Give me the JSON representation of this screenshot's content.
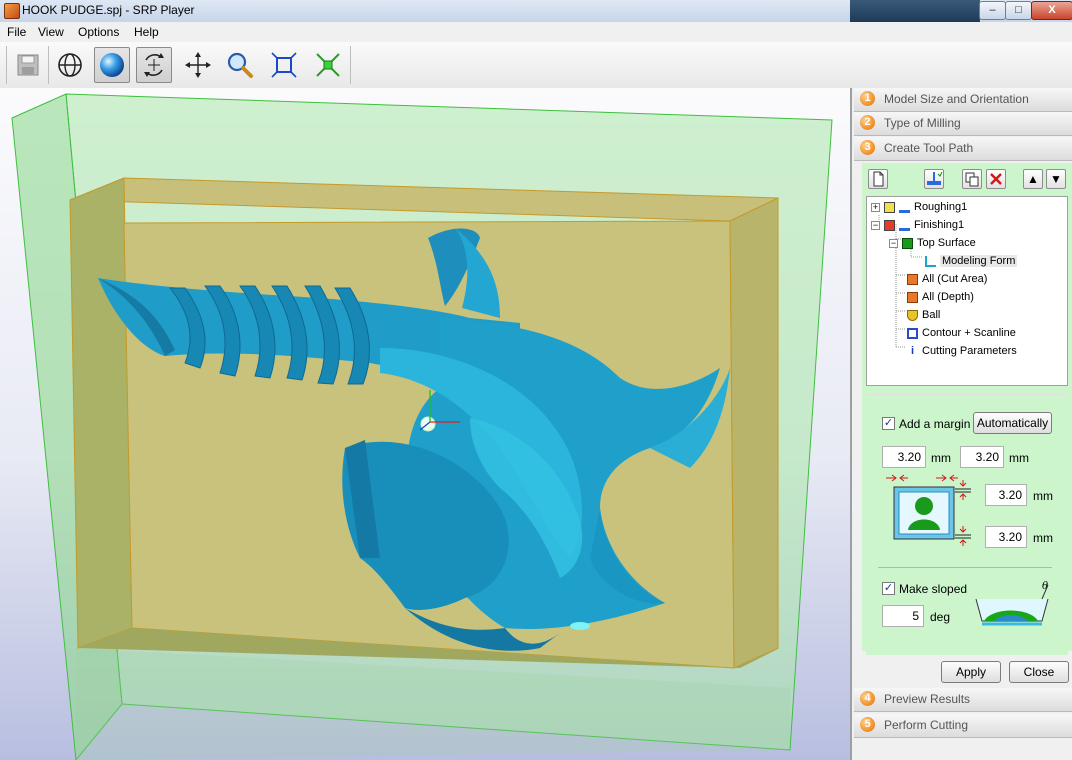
{
  "window": {
    "title": "HOOK PUDGE.spj - SRP Player",
    "controls": {
      "minimize": "–",
      "maximize": "□",
      "close": "X"
    }
  },
  "menu": [
    "File",
    "View",
    "Options",
    "Help"
  ],
  "toolbar": {
    "buttons": [
      "save-icon",
      "globe-icon",
      "shaded-sphere-icon",
      "rotate-icon",
      "pan-icon",
      "zoom-icon",
      "fit-view-icon",
      "zoom-extents-icon"
    ],
    "active": [
      "shaded-sphere-icon",
      "rotate-icon"
    ]
  },
  "steps": [
    {
      "num": "1",
      "label": "Model Size and Orientation"
    },
    {
      "num": "2",
      "label": "Type of Milling"
    },
    {
      "num": "3",
      "label": "Create Tool Path"
    },
    {
      "num": "4",
      "label": "Preview Results"
    },
    {
      "num": "5",
      "label": "Perform Cutting"
    }
  ],
  "step_toolbar": {
    "new": "new-file-icon",
    "mill": "mill-process-icon",
    "copy": "copy-icon",
    "delete": "delete-icon",
    "up": "▲",
    "down": "▼"
  },
  "tree": {
    "roughing": "Roughing1",
    "finishing": "Finishing1",
    "top_surface": "Top Surface",
    "modeling_form": "Modeling Form",
    "cut_area": "All (Cut Area)",
    "depth": "All (Depth)",
    "tool": "Ball",
    "path_type": "Contour + Scanline",
    "cutting_params": "Cutting Parameters"
  },
  "margin": {
    "add_label": "Add a margin",
    "add_checked": true,
    "auto_button": "Automatically",
    "x1": "3.20",
    "x2": "3.20",
    "y1": "3.20",
    "y2": "3.20",
    "unit": "mm"
  },
  "slope": {
    "label": "Make sloped",
    "checked": true,
    "value": "5",
    "unit": "deg",
    "theta": "θ"
  },
  "buttons": {
    "apply": "Apply",
    "close": "Close"
  },
  "colors": {
    "accent_orange": "#f08a1e",
    "model_cyan": "#1e9ec8",
    "stock_yellow": "#c6c27a",
    "bounding_green": "#9bd89b",
    "panel_green": "#ccf5cc"
  }
}
